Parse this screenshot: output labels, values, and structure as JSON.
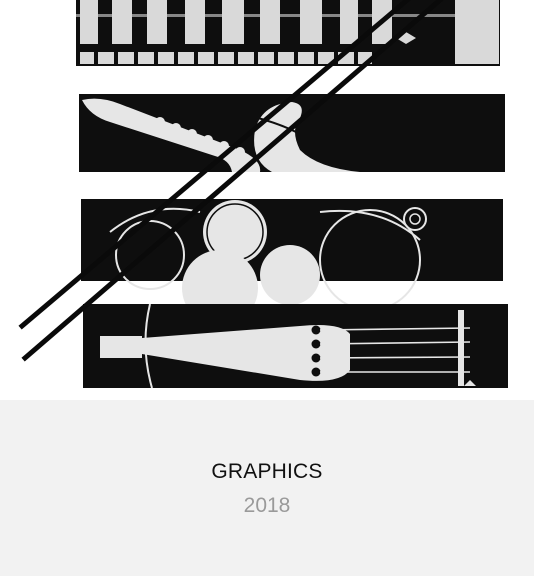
{
  "project": {
    "title": "GRAPHICS",
    "year": "2018"
  },
  "artwork": {
    "subject": "piano-saxophone-drums-violin-illustration"
  },
  "colors": {
    "caption_bg": "#f2f2f2",
    "title": "#111111",
    "year": "#9a9a9a"
  }
}
